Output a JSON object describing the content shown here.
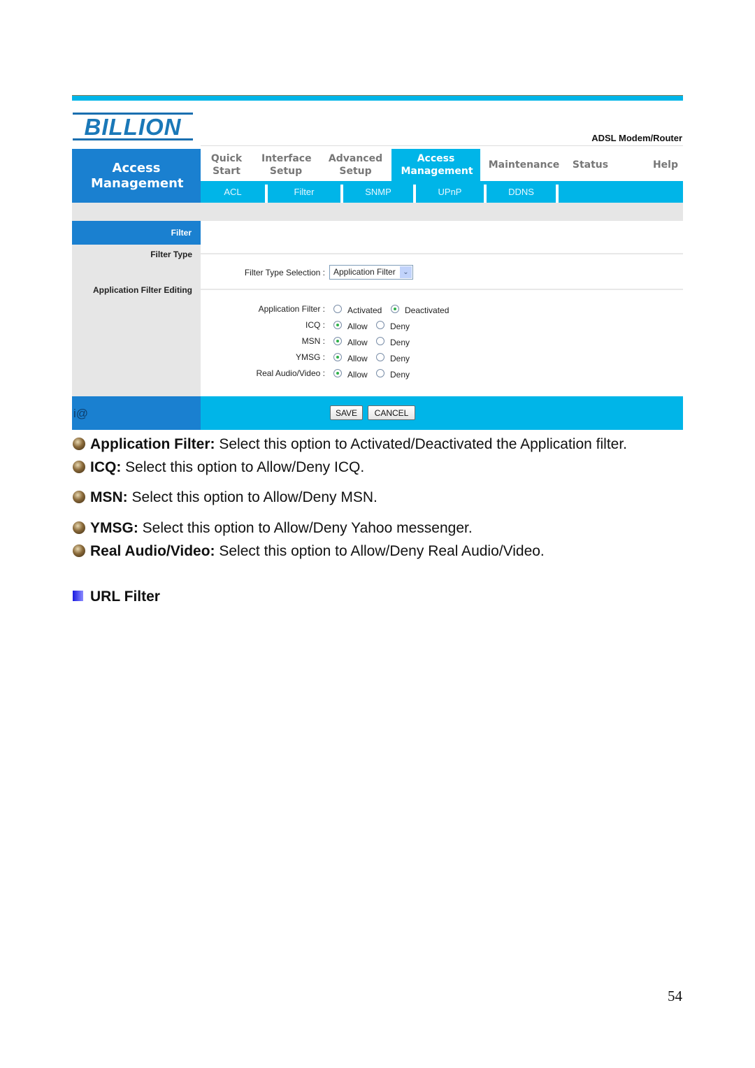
{
  "router_ui": {
    "logo_text": "BILLION",
    "product_label": "ADSL Modem/Router",
    "section_title": "Access Management",
    "main_nav": [
      {
        "label": "Quick Start",
        "active": false
      },
      {
        "label": "Interface Setup",
        "active": false
      },
      {
        "label": "Advanced Setup",
        "active": false
      },
      {
        "label": "Access Management",
        "active": true
      },
      {
        "label": "Maintenance",
        "active": false
      },
      {
        "label": "Status",
        "active": false
      },
      {
        "label": "Help",
        "active": false
      }
    ],
    "sub_nav": [
      "ACL",
      "Filter",
      "SNMP",
      "UPnP",
      "DDNS"
    ],
    "left_panel": {
      "header": "Filter",
      "filter_type_label": "Filter Type",
      "app_filter_editing_label": "Application Filter Editing"
    },
    "filter_type": {
      "label": "Filter Type Selection :",
      "selected": "Application Filter"
    },
    "application_filter": {
      "label": "Application Filter :",
      "options": [
        "Activated",
        "Deactivated"
      ],
      "selected": "Deactivated"
    },
    "apps": [
      {
        "label": "ICQ :",
        "allow": "Allow",
        "deny": "Deny",
        "selected": "Allow"
      },
      {
        "label": "MSN :",
        "allow": "Allow",
        "deny": "Deny",
        "selected": "Allow"
      },
      {
        "label": "YMSG :",
        "allow": "Allow",
        "deny": "Deny",
        "selected": "Allow"
      },
      {
        "label": "Real Audio/Video :",
        "allow": "Allow",
        "deny": "Deny",
        "selected": "Allow"
      }
    ],
    "footer_icon": "i@",
    "buttons": {
      "save": "SAVE",
      "cancel": "CANCEL"
    }
  },
  "document": {
    "bullets": [
      {
        "term": "Application Filter:",
        "text": " Select this option to Activated/Deactivated the Application filter."
      },
      {
        "term": "ICQ:",
        "text": " Select this option to Allow/Deny ICQ."
      },
      {
        "term": "MSN:",
        "text": " Select this option to Allow/Deny MSN."
      },
      {
        "term": "YMSG:",
        "text": " Select this option to Allow/Deny Yahoo messenger."
      },
      {
        "term": "Real Audio/Video:",
        "text": " Select this option to Allow/Deny Real Audio/Video."
      }
    ],
    "subheading": "URL Filter",
    "page_number": "54"
  },
  "colors": {
    "dark_blue": "#1a80d0",
    "light_blue": "#00b5e8",
    "grey_panel": "#e6e6e6"
  }
}
